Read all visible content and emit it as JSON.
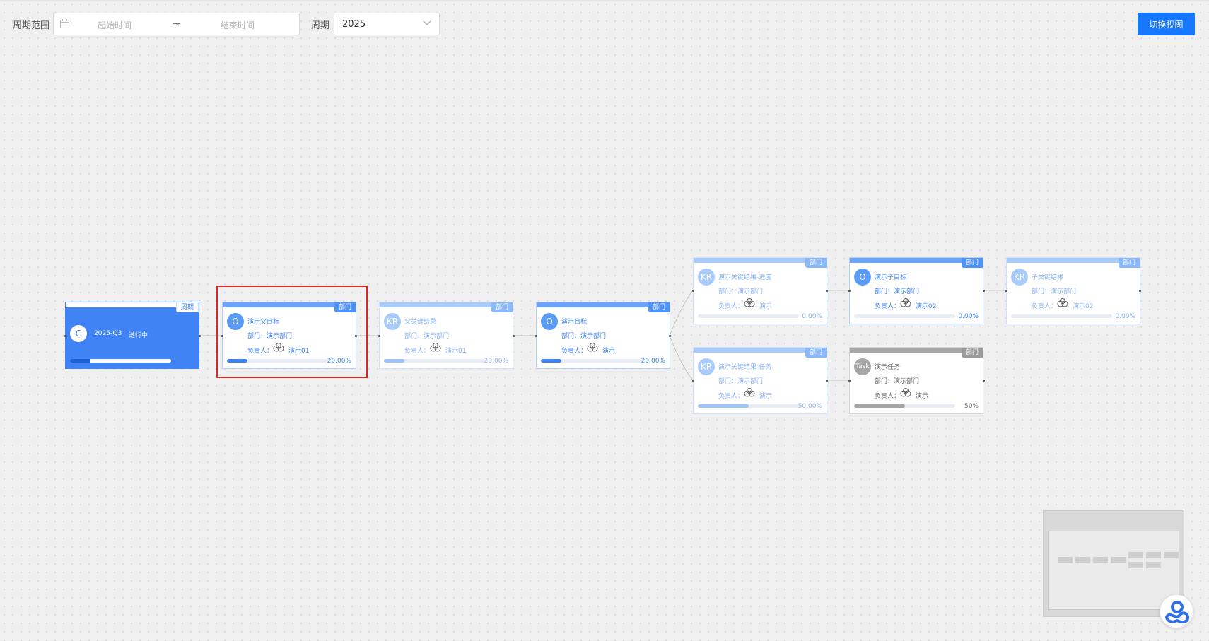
{
  "toolbar": {
    "period_range_label": "周期范围",
    "start_placeholder": "起始时间",
    "range_separator": "~",
    "end_placeholder": "结束时间",
    "period_label": "周期",
    "period_value": "2025",
    "switch_view_label": "切换视图"
  },
  "colors": {
    "primary": "#1677ff",
    "node_blue": "#3f83f5",
    "selection": "#e02424",
    "task_gray": "#a6a6a6"
  },
  "cycle_node": {
    "tag": "周期",
    "avatar": "C",
    "name": "2025-Q3",
    "status": "进行中",
    "progress_pct": "20.00%",
    "progress": 0.2
  },
  "nodes": {
    "parent_objective": {
      "tag": "部门",
      "avatar": "O",
      "title": "演示父目标",
      "dept": "部门：演示部门",
      "owner_label": "负责人：",
      "owner": "演示01",
      "pct": "20.00%",
      "progress": 0.2
    },
    "parent_kr": {
      "tag": "部门",
      "avatar": "KR",
      "title": "父关键结果",
      "dept": "部门：演示部门",
      "owner_label": "负责人：",
      "owner": "演示01",
      "pct": "20.00%",
      "progress": 0.2
    },
    "objective": {
      "tag": "部门",
      "avatar": "O",
      "title": "演示目标",
      "dept": "部门：演示部门",
      "owner_label": "负责人：",
      "owner": "演示",
      "pct": "20.00%",
      "progress": 0.2
    },
    "kr_progress": {
      "tag": "部门",
      "avatar": "KR",
      "title": "演示关键结果-进度",
      "dept": "部门：演示部门",
      "owner_label": "负责人：",
      "owner": "演示",
      "pct": "0.00%",
      "progress": 0
    },
    "kr_task": {
      "tag": "部门",
      "avatar": "KR",
      "title": "演示关键结果-任务",
      "dept": "部门：演示部门",
      "owner_label": "负责人：",
      "owner": "演示",
      "pct": "50.00%",
      "progress": 0.5
    },
    "child_objective": {
      "tag": "部门",
      "avatar": "O",
      "title": "演示子目标",
      "dept": "部门：演示部门",
      "owner_label": "负责人：",
      "owner": "演示02",
      "pct": "0.00%",
      "progress": 0
    },
    "child_kr": {
      "tag": "部门",
      "avatar": "KR",
      "title": "子关键结果",
      "dept": "部门：演示部门",
      "owner_label": "负责人：",
      "owner": "演示02",
      "pct": "0.00%",
      "progress": 0
    },
    "task": {
      "tag": "部门",
      "avatar": "Task",
      "title": "演示任务",
      "dept": "部门：演示部门",
      "owner_label": "负责人：",
      "owner": "演示",
      "pct": "50%",
      "progress": 0.5
    }
  },
  "icons": {
    "calendar": "calendar-icon",
    "chevron": "chevron-down-icon",
    "owner": "user-group-icon",
    "help": "help-assistant-icon"
  }
}
